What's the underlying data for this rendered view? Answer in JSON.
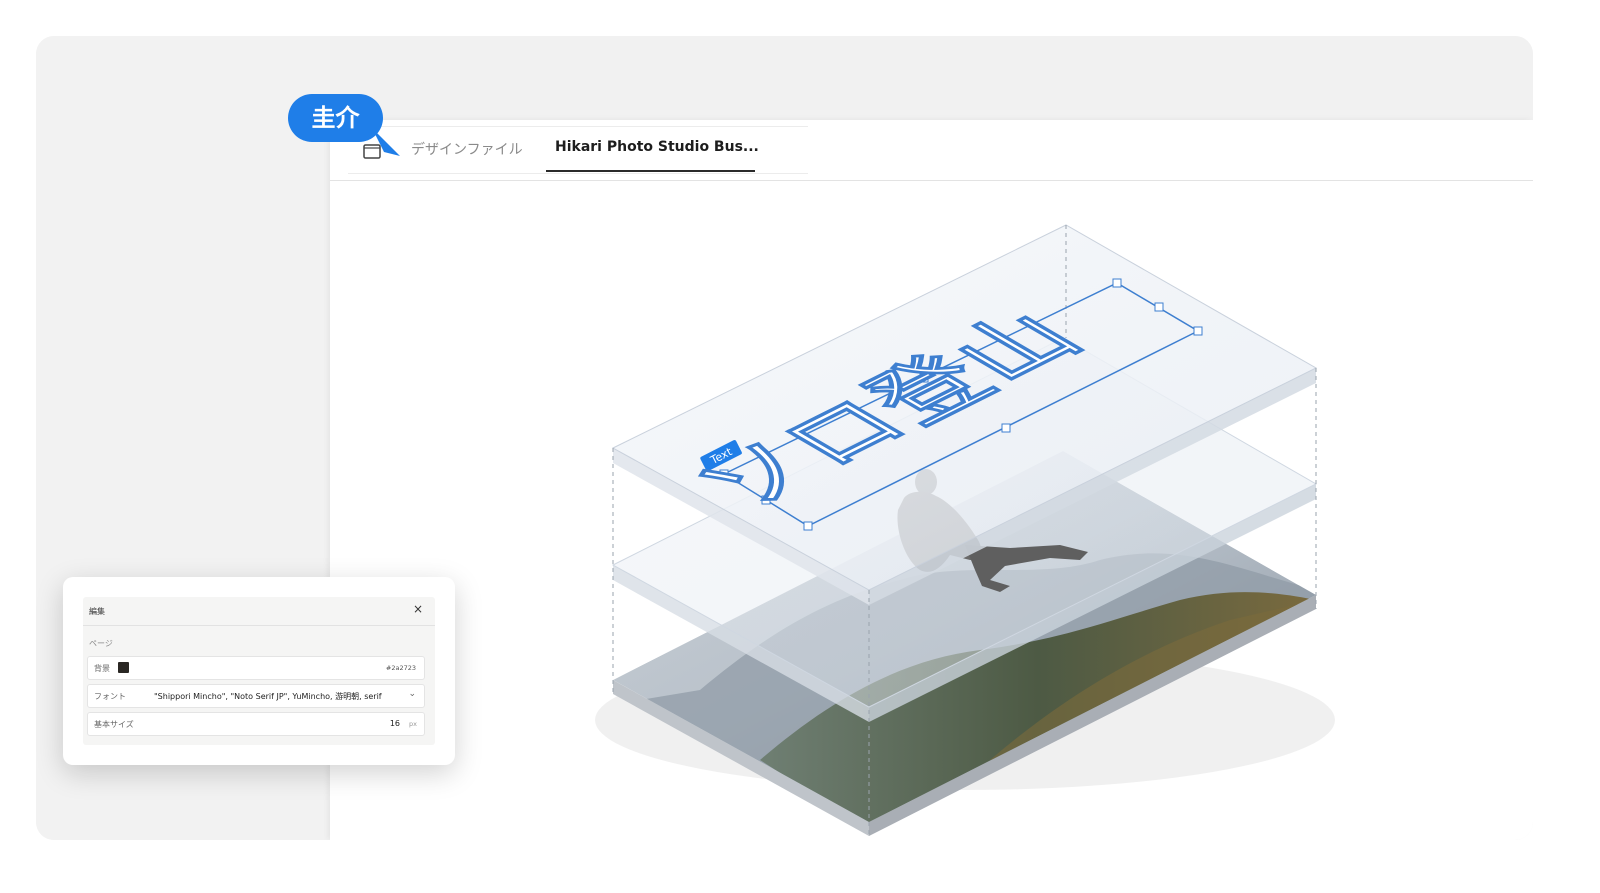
{
  "user": {
    "name": "圭介"
  },
  "tabs": [
    {
      "label": "デザインファイル",
      "active": false
    },
    {
      "label": "Hikari Photo Studio Bus...",
      "active": true
    }
  ],
  "canvas": {
    "text_layer": {
      "tag": "Text",
      "content": "ソロ登山"
    }
  },
  "edit_panel": {
    "title": "編集",
    "close_symbol": "×",
    "section": "ページ",
    "background": {
      "label": "背景",
      "color": "#2a2723",
      "value": "#2a2723"
    },
    "font": {
      "label": "フォント",
      "value": "\"Shippori Mincho\", \"Noto Serif JP\", YuMincho, 游明朝, serif"
    },
    "base_size": {
      "label": "基本サイズ",
      "value": "16",
      "unit": "px"
    }
  },
  "colors": {
    "accent": "#1f7ee8",
    "selection": "#3e7fd0"
  }
}
